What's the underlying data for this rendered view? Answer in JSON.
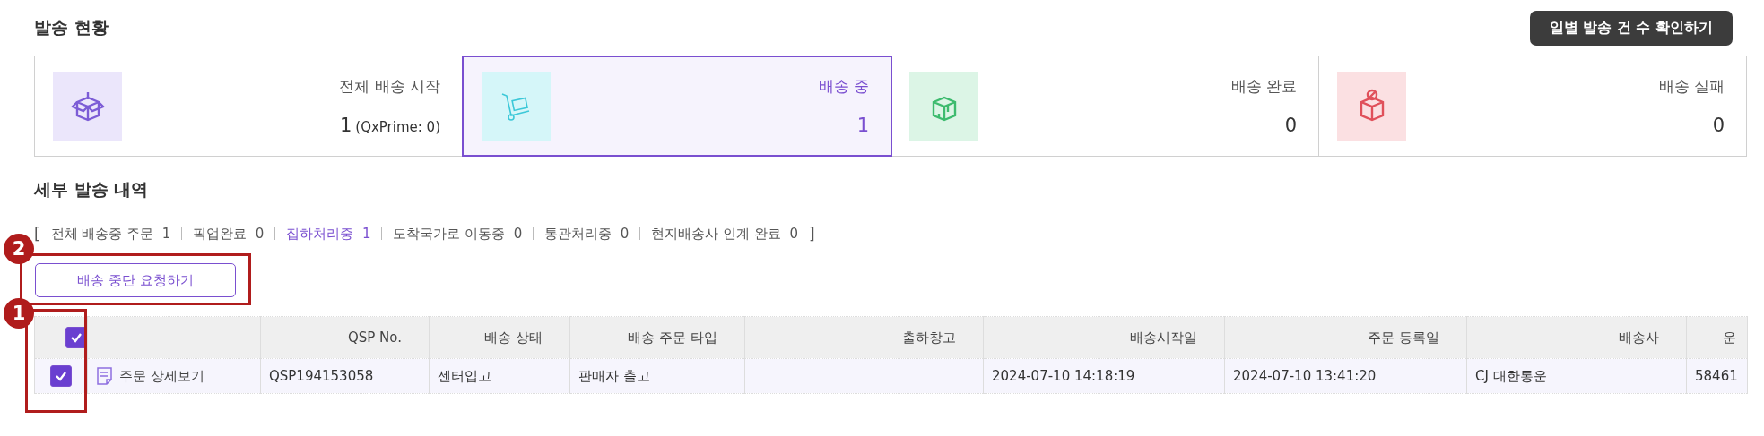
{
  "status_title": "발송 현황",
  "daily_button": "일별 발송 건 수 확인하기",
  "cards": [
    {
      "kind": "start",
      "label": "전체 배송 시작",
      "count": "1",
      "note": "(QxPrime: 0)",
      "selected": false,
      "color": "#7c5cd6"
    },
    {
      "kind": "moving",
      "label": "배송 중",
      "count": "1",
      "selected": true,
      "color": "#3cc8d8"
    },
    {
      "kind": "done",
      "label": "배송 완료",
      "count": "0",
      "selected": false,
      "color": "#3dbb6e"
    },
    {
      "kind": "failed",
      "label": "배송 실패",
      "count": "0",
      "selected": false,
      "color": "#e0505a"
    }
  ],
  "detail_title": "세부 발송 내역",
  "filters": {
    "open_bracket": "[",
    "close_bracket": "]",
    "items": [
      {
        "label": "전체 배송중 주문",
        "count": "1",
        "selected": false
      },
      {
        "label": "픽업완료",
        "count": "0",
        "selected": false
      },
      {
        "label": "집하처리중",
        "count": "1",
        "selected": true
      },
      {
        "label": "도착국가로 이동중",
        "count": "0",
        "selected": false
      },
      {
        "label": "통관처리중",
        "count": "0",
        "selected": false
      },
      {
        "label": "현지배송사 인계 완료",
        "count": "0",
        "selected": false
      }
    ]
  },
  "stop_button": "배송 중단 요청하기",
  "callouts": [
    "2",
    "1"
  ],
  "table": {
    "all_checked": true,
    "columns": [
      "",
      "QSP No.",
      "배송 상태",
      "배송 주문 타입",
      "출하창고",
      "배송시작일",
      "주문 등록일",
      "배송사",
      "운"
    ],
    "rows": [
      {
        "checked": true,
        "cells": [
          "주문 상세보기",
          "QSP194153058",
          "센터입고",
          "판매자 출고",
          "",
          "2024-07-10 14:18:19",
          "2024-07-10 13:41:20",
          "CJ 대한통운",
          "58461"
        ]
      }
    ]
  }
}
